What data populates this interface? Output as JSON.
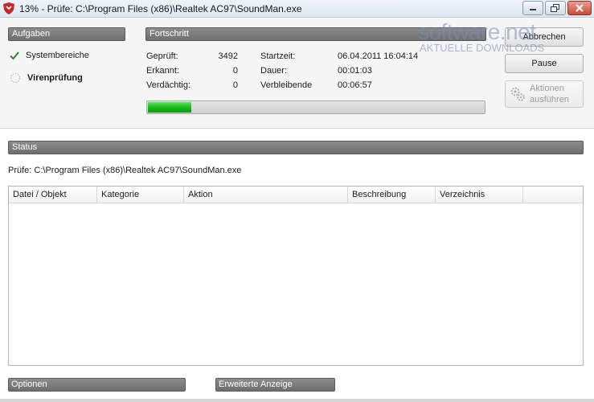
{
  "window": {
    "title": "13% - Prüfe: C:\\Program Files (x86)\\Realtek AC97\\SoundMan.exe",
    "icons": {
      "app": "shield-icon",
      "minimize": "minimize-icon",
      "maximize": "maximize-icon",
      "close": "close-icon"
    }
  },
  "tasks": {
    "header": "Aufgaben",
    "items": [
      {
        "label": "Systembereiche",
        "state": "done",
        "icon": "checkmark-icon"
      },
      {
        "label": "Virenprüfung",
        "state": "in-progress",
        "icon": "spinner-icon"
      }
    ]
  },
  "progress": {
    "header": "Fortschritt",
    "checked_label": "Geprüft:",
    "checked_value": "3492",
    "found_label": "Erkannt:",
    "found_value": "0",
    "suspicious_label": "Verdächtig:",
    "suspicious_value": "0",
    "start_label": "Startzeit:",
    "start_value": "06.04.2011 16:04:14",
    "duration_label": "Dauer:",
    "duration_value": "00:01:03",
    "remaining_label": "Verbleibende",
    "remaining_value": "00:06:57",
    "percent": 13
  },
  "actions": {
    "cancel_label": "Abbrechen",
    "pause_label": "Pause",
    "run_actions_label": "Aktionen ausführen",
    "run_actions_icon": "gears-icon"
  },
  "watermark": {
    "main": "software.net",
    "sub": "AKTUELLE DOWNLOADS"
  },
  "status": {
    "header": "Status",
    "current_path": "Prüfe: C:\\Program Files (x86)\\Realtek AC97\\SoundMan.exe"
  },
  "table": {
    "columns": [
      "Datei / Objekt",
      "Kategorie",
      "Aktion",
      "Beschreibung",
      "Verzeichnis"
    ],
    "rows": []
  },
  "footer": {
    "options_label": "Optionen",
    "advanced_label": "Erweiterte Anzeige"
  },
  "colors": {
    "progress_fill": "#16b816",
    "section_bar": "#7a7a7a",
    "check": "#2a8a2a",
    "app_icon": "#c62828"
  }
}
